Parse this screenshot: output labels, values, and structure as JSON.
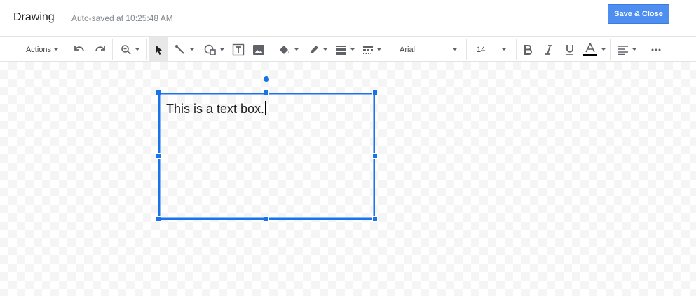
{
  "header": {
    "title": "Drawing",
    "autosave": "Auto-saved at 10:25:48 AM",
    "save_close_label": "Save & Close"
  },
  "toolbar": {
    "actions_label": "Actions",
    "font_name": "Arial",
    "font_size": "14"
  },
  "canvas": {
    "textbox_text": "This is a text box."
  },
  "colors": {
    "accent": "#4d8ef0",
    "selection": "#1a73e8",
    "text_color_underline": "#000000"
  }
}
